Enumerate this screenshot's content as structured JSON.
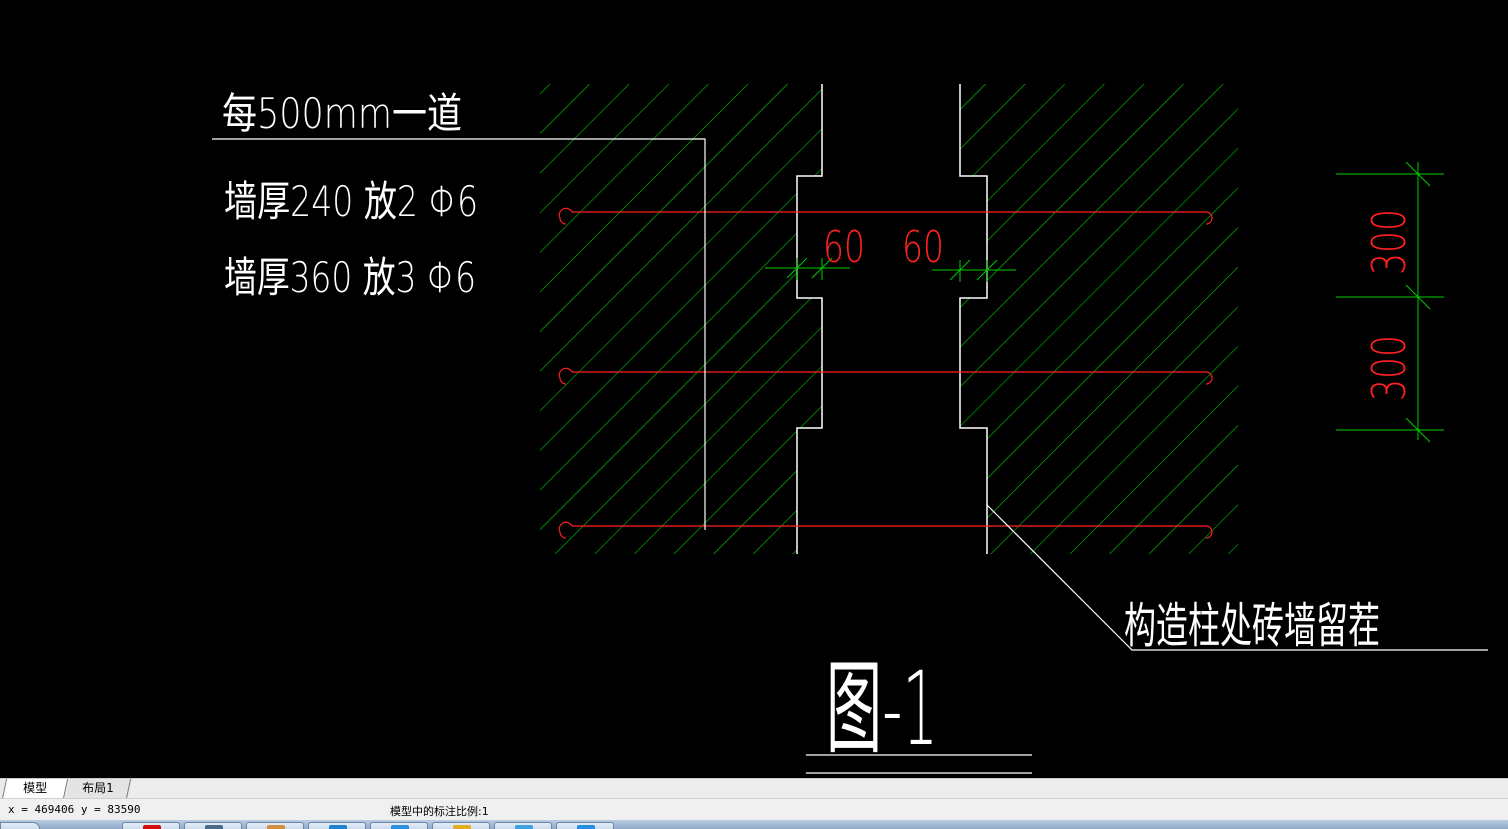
{
  "drawing": {
    "note_line1": "每500mm一道",
    "note_line2": "墙厚240 放2 Φ6",
    "note_line3": "墙厚360 放3 Φ6",
    "dim_left_60": "60",
    "dim_right_60": "60",
    "dim_top_300": "300",
    "dim_bottom_300": "300",
    "callout_label": "构造柱处砖墙留茬",
    "figure_title": "图-1",
    "colors": {
      "background": "#000000",
      "lines": "#ffffff",
      "hatch": "#00cc00",
      "rebar": "#ff2020",
      "dimension": "#00cc00"
    }
  },
  "tabs": {
    "model_label": "模型",
    "layout1_label": "布局1"
  },
  "status": {
    "coordinates": "x = 469406 y = 83590",
    "annotation_scale": "模型中的标注比例:1"
  }
}
